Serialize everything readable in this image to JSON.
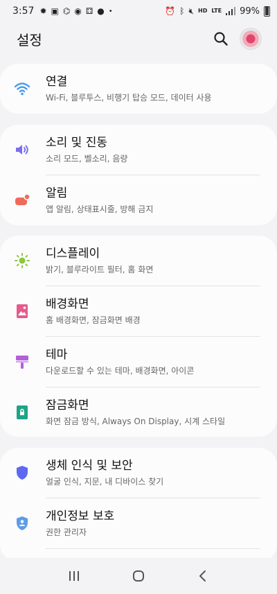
{
  "status_bar": {
    "time": "3:57",
    "battery": "99%",
    "signal_labels": [
      "HD",
      "LTE"
    ]
  },
  "header": {
    "title": "설정"
  },
  "colors": {
    "background": "#f3f3f5",
    "card": "#fcfcfc",
    "wifi": "#4a9bea",
    "sound": "#7b6ef0",
    "notifications": "#f06a5a",
    "display": "#8dc63f",
    "wallpaper": "#e45b8c",
    "themes": "#b45fdc",
    "lockscreen": "#1fa38a",
    "biometrics": "#5d6af0",
    "privacy": "#5f9be6"
  },
  "groups": [
    {
      "items": [
        {
          "icon": "wifi-icon",
          "title": "연결",
          "subtitle": "Wi-Fi, 블루투스, 비행기 탑승 모드, 데이터 사용"
        }
      ]
    },
    {
      "items": [
        {
          "icon": "volume-icon",
          "title": "소리 및 진동",
          "subtitle": "소리 모드, 벨소리, 음량"
        },
        {
          "icon": "notification-icon",
          "title": "알림",
          "subtitle": "앱 알림, 상태표시줄, 방해 금지"
        }
      ]
    },
    {
      "items": [
        {
          "icon": "brightness-icon",
          "title": "디스플레이",
          "subtitle": "밝기, 블루라이트 필터, 홈 화면"
        },
        {
          "icon": "wallpaper-icon",
          "title": "배경화면",
          "subtitle": "홈 배경화면, 잠금화면 배경"
        },
        {
          "icon": "theme-brush-icon",
          "title": "테마",
          "subtitle": "다운로드할 수 있는 테마, 배경화면, 아이콘"
        },
        {
          "icon": "lock-screen-icon",
          "title": "잠금화면",
          "subtitle": "화면 잠금 방식, Always On Display, 시계 스타일"
        }
      ]
    },
    {
      "items": [
        {
          "icon": "shield-icon",
          "title": "생체 인식 및 보안",
          "subtitle": "얼굴 인식, 지문, 내 디바이스 찾기"
        },
        {
          "icon": "privacy-icon",
          "title": "개인정보 보호",
          "subtitle": "권한 관리자"
        }
      ]
    }
  ]
}
